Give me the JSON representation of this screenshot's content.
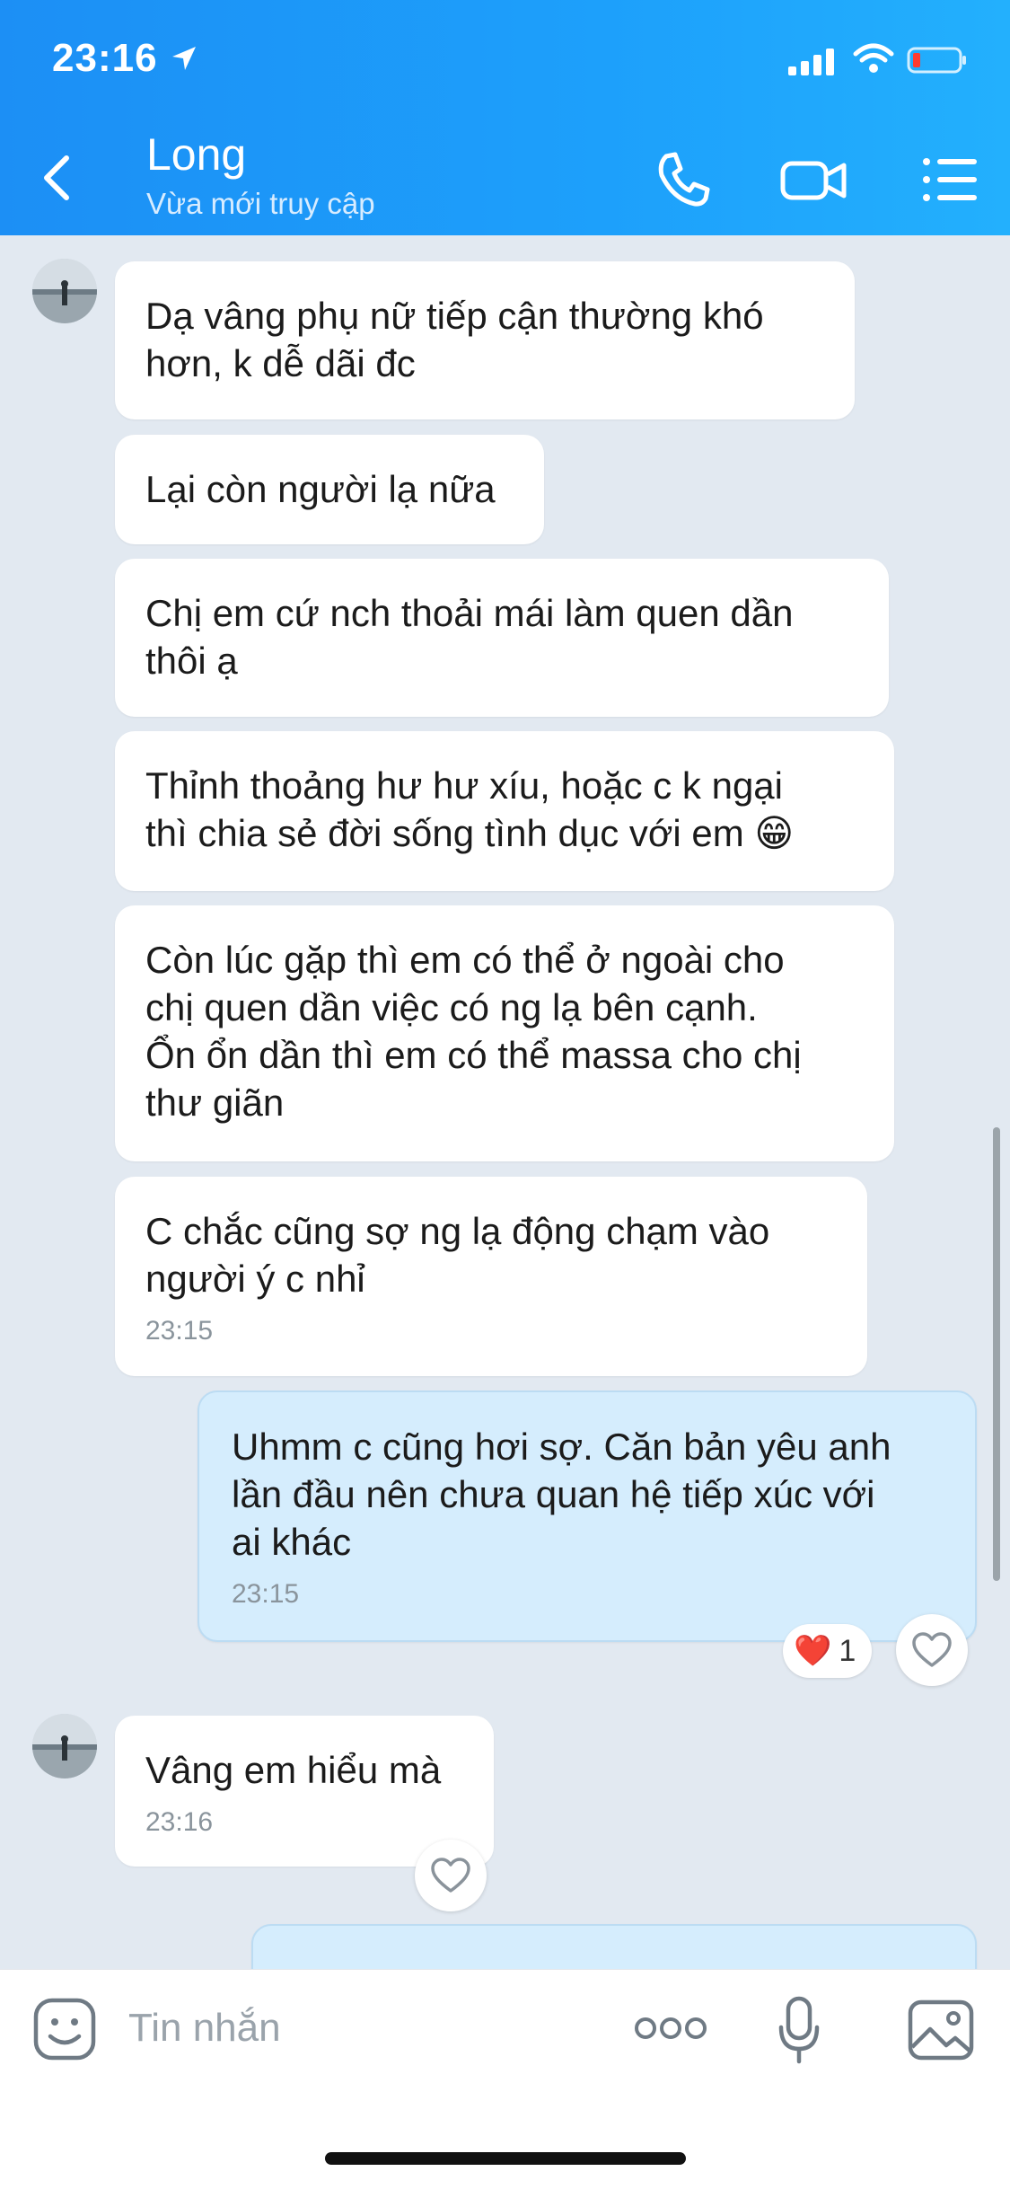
{
  "status_bar": {
    "time": "23:16"
  },
  "header": {
    "contact_name": "Long",
    "presence": "Vừa mới truy cập",
    "icons": [
      "back-icon",
      "phone-icon",
      "video-call-icon",
      "menu-list-icon"
    ]
  },
  "messages": [
    {
      "from": "them",
      "text": "Dạ vâng phụ nữ tiếp cận thường khó\nhơn, k dễ dãi đc",
      "time": ""
    },
    {
      "from": "them",
      "text": "Lại còn người lạ nữa",
      "time": ""
    },
    {
      "from": "them",
      "text": "Chị em cứ nch thoải mái làm quen dần\nthôi ạ",
      "time": ""
    },
    {
      "from": "them",
      "text": "Thỉnh thoảng hư hư xíu, hoặc c k ngại\nthì chia sẻ đời sống tình dục với em 😁",
      "time": ""
    },
    {
      "from": "them",
      "text": "Còn lúc gặp thì em có thể ở ngoài cho\nchị quen dần việc có ng lạ bên cạnh.\nỔn ổn dần thì em có thể massa cho chị\nthư giãn",
      "time": ""
    },
    {
      "from": "them",
      "text": "C chắc cũng sợ ng lạ động chạm vào\nngười ý c nhỉ",
      "time": "23:15"
    },
    {
      "from": "me",
      "text": "Uhmm c cũng hơi sợ. Căn bản yêu anh\nlần đầu nên chưa quan hệ tiếp xúc với\nai khác",
      "time": "23:15",
      "reaction": {
        "emoji": "❤️",
        "count": "1"
      }
    },
    {
      "from": "them",
      "text": "Vâng em hiểu mà",
      "time": "23:16"
    }
  ],
  "input": {
    "placeholder": "Tin nhắn"
  },
  "colors": {
    "header": "#1d9bf8",
    "my_bubble": "#d5edfd",
    "background": "#e2e9f1"
  }
}
